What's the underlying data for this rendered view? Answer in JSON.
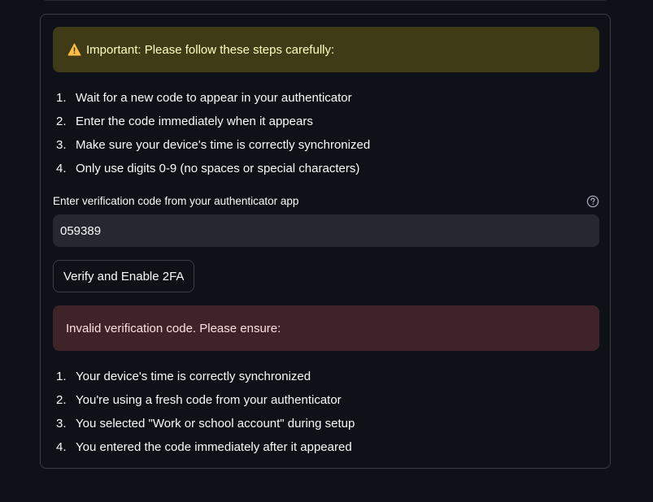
{
  "warning": {
    "icon": "warning-icon",
    "text": "Important: Please follow these steps carefully:",
    "color": "#ffffc2",
    "background": "#3e3b16"
  },
  "steps": [
    {
      "num": "1.",
      "text": "Wait for a new code to appear in your authenticator"
    },
    {
      "num": "2.",
      "text": "Enter the code immediately when it appears"
    },
    {
      "num": "3.",
      "text": "Make sure your device's time is correctly synchronized"
    },
    {
      "num": "4.",
      "text": "Only use digits 0-9 (no spaces or special characters)"
    }
  ],
  "code_field": {
    "label": "Enter verification code from your authenticator app",
    "value": "059389",
    "help_icon": "help-circle-icon"
  },
  "verify_button": {
    "label": "Verify and Enable 2FA"
  },
  "error": {
    "text": "Invalid verification code. Please ensure:",
    "color": "#ffdede",
    "background": "#3e2428"
  },
  "ensure_items": [
    {
      "num": "1.",
      "text": "Your device's time is correctly synchronized"
    },
    {
      "num": "2.",
      "text": "You're using a fresh code from your authenticator"
    },
    {
      "num": "3.",
      "text": "You selected \"Work or school account\" during setup"
    },
    {
      "num": "4.",
      "text": "You entered the code immediately after it appeared"
    }
  ]
}
